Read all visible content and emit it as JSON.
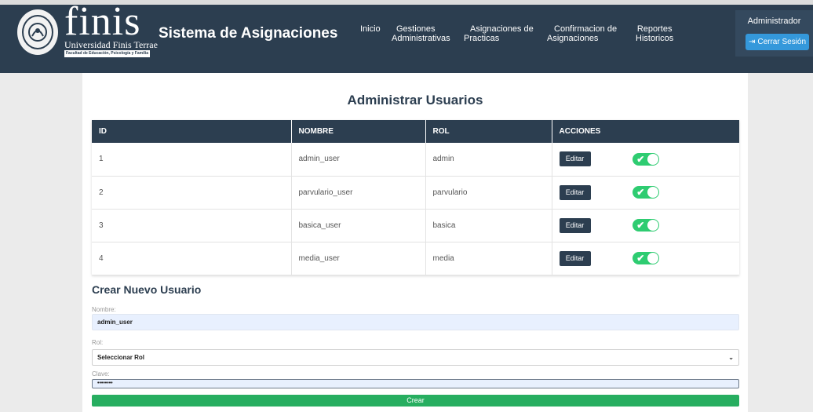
{
  "header": {
    "brand_word": "finis",
    "brand_university": "Universidad Finis Terrae",
    "brand_faculty": "Facultad de Educación, Psicología y Familia",
    "app_title": "Sistema de Asignaciones",
    "nav": [
      {
        "label": "Inicio"
      },
      {
        "label": "Gestiones\nAdministrativas"
      },
      {
        "label": "Asignaciones de\nPracticas"
      },
      {
        "label": "Confirmacion de\nAsignaciones"
      },
      {
        "label": "Reportes\nHistoricos"
      }
    ],
    "user_role": "Administrador",
    "logout_label": "Cerrar Sesión",
    "colors": {
      "header_bg": "#2c3e50",
      "logout_bg": "#3498db"
    }
  },
  "main": {
    "title": "Administrar Usuarios",
    "table": {
      "columns": [
        "ID",
        "NOMBRE",
        "ROL",
        "ACCIONES"
      ],
      "rows": [
        {
          "id": "1",
          "nombre": "admin_user",
          "rol": "admin",
          "edit_label": "Editar",
          "active": true
        },
        {
          "id": "2",
          "nombre": "parvulario_user",
          "rol": "parvulario",
          "edit_label": "Editar",
          "active": true
        },
        {
          "id": "3",
          "nombre": "basica_user",
          "rol": "basica",
          "edit_label": "Editar",
          "active": true
        },
        {
          "id": "4",
          "nombre": "media_user",
          "rol": "media",
          "edit_label": "Editar",
          "active": true
        }
      ]
    },
    "form": {
      "title": "Crear Nuevo Usuario",
      "name_label": "Nombre:",
      "name_value": "admin_user",
      "rol_label": "Rol:",
      "rol_selected": "Seleccionar Rol",
      "password_label": "Clave:",
      "password_value": "••••••••",
      "submit_label": "Crear",
      "colors": {
        "submit_bg": "#27ae60",
        "toggle_on": "#2ecc71"
      }
    }
  }
}
